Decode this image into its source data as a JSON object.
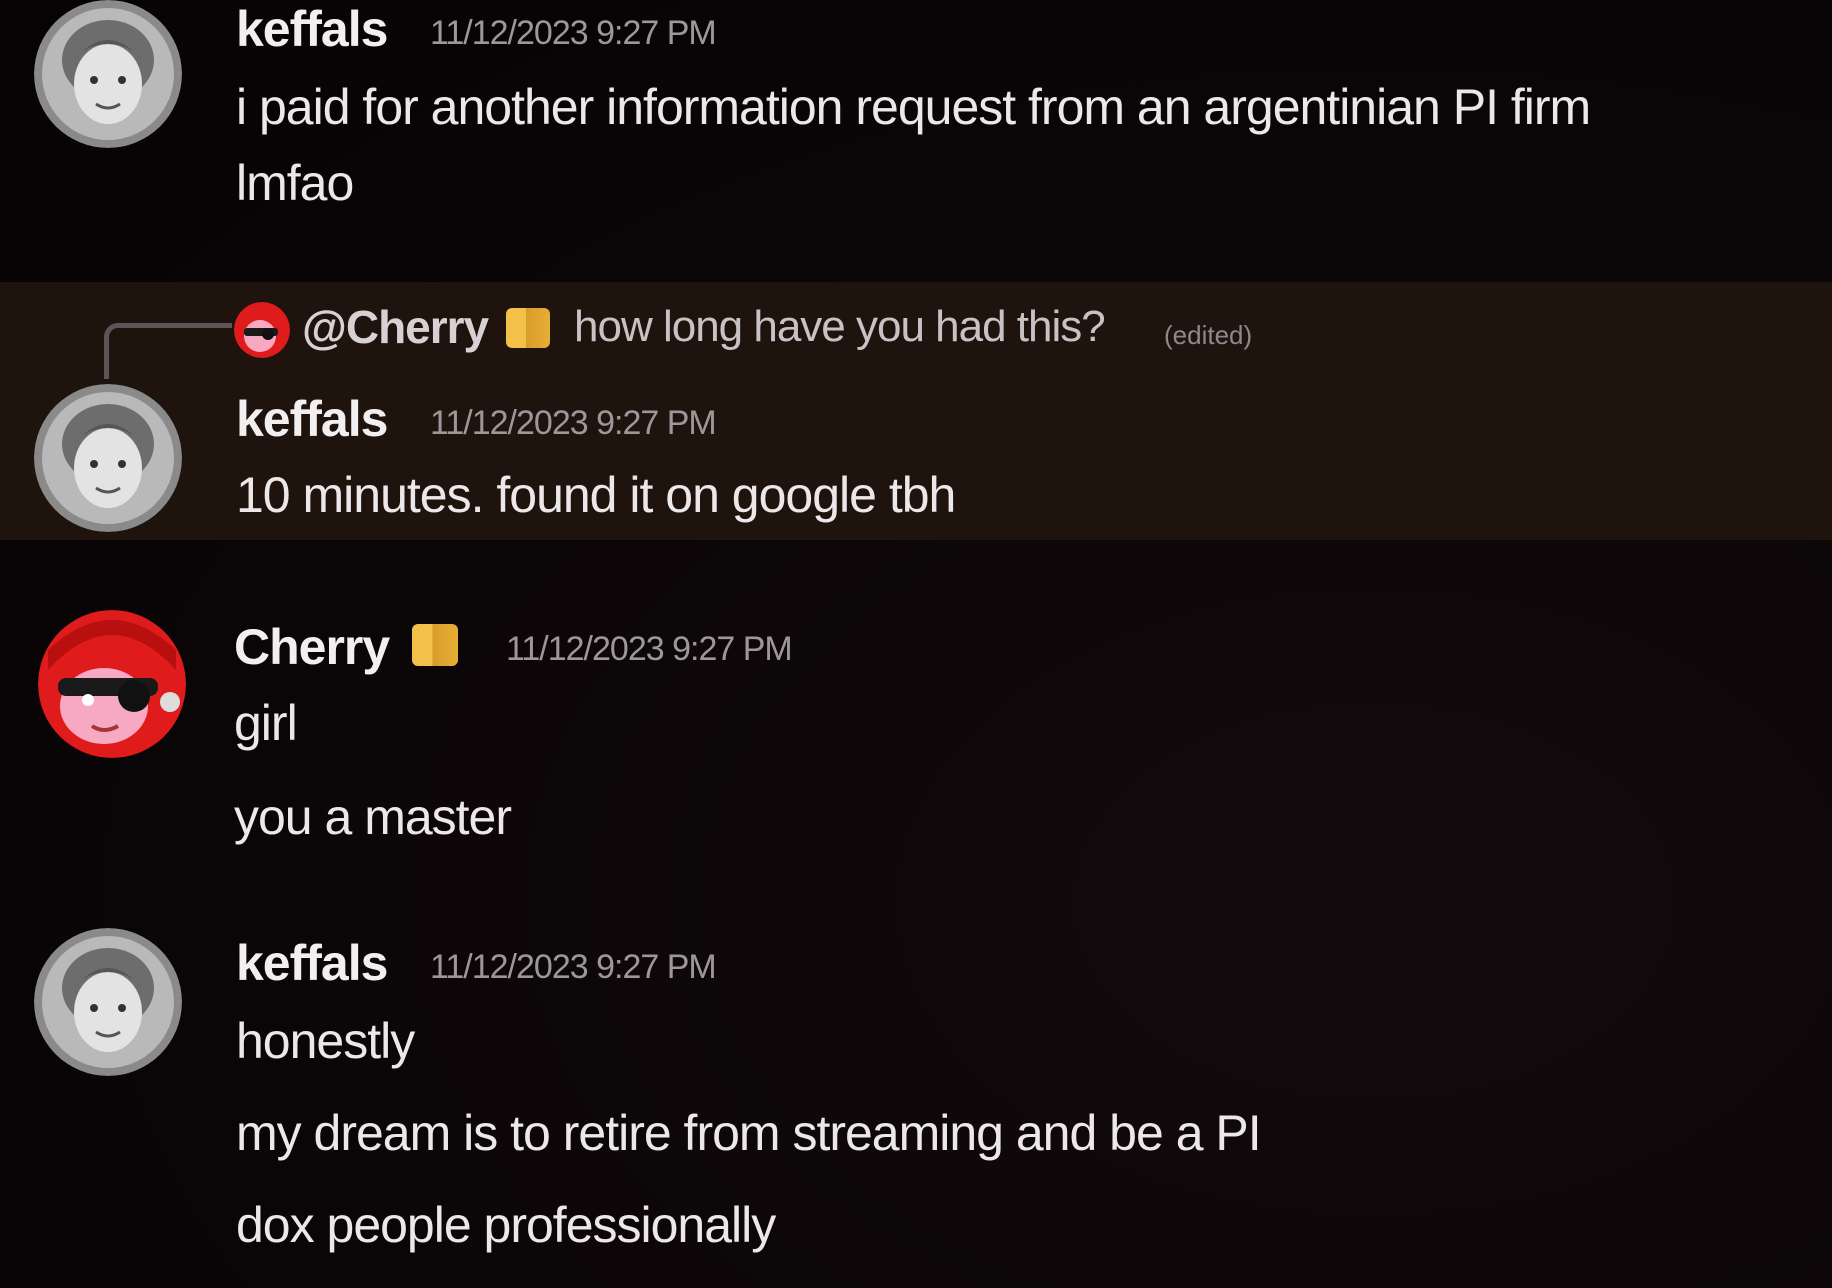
{
  "colors": {
    "background": "#0b0609",
    "highlight": "#1f140d",
    "username": "#f2eff0",
    "timestamp": "#9d979a",
    "badge": "#f3c14a",
    "cherry_red": "#e01b1b"
  },
  "messages": [
    {
      "avatar_icon": "keffals-avatar",
      "username": "keffals",
      "timestamp": "11/12/2023 9:27 PM",
      "lines": [
        "i paid for another information request from an argentinian PI firm",
        "lmfao"
      ]
    },
    {
      "reply_to": {
        "avatar_icon": "cherry-avatar",
        "mention": "@Cherry",
        "text": "how long have you had this?",
        "edited": "(edited)"
      },
      "avatar_icon": "keffals-avatar",
      "username": "keffals",
      "timestamp": "11/12/2023 9:27 PM",
      "lines": [
        "10 minutes. found it on google tbh"
      ]
    },
    {
      "avatar_icon": "cherry-avatar",
      "username": "Cherry",
      "badge_icon": "role-badge-icon",
      "timestamp": "11/12/2023 9:27 PM",
      "lines": [
        "girl",
        "you a master"
      ]
    },
    {
      "avatar_icon": "keffals-avatar",
      "username": "keffals",
      "timestamp": "11/12/2023 9:27 PM",
      "lines": [
        "honestly",
        "my dream is to retire from streaming and be a PI",
        "dox people professionally"
      ]
    }
  ]
}
